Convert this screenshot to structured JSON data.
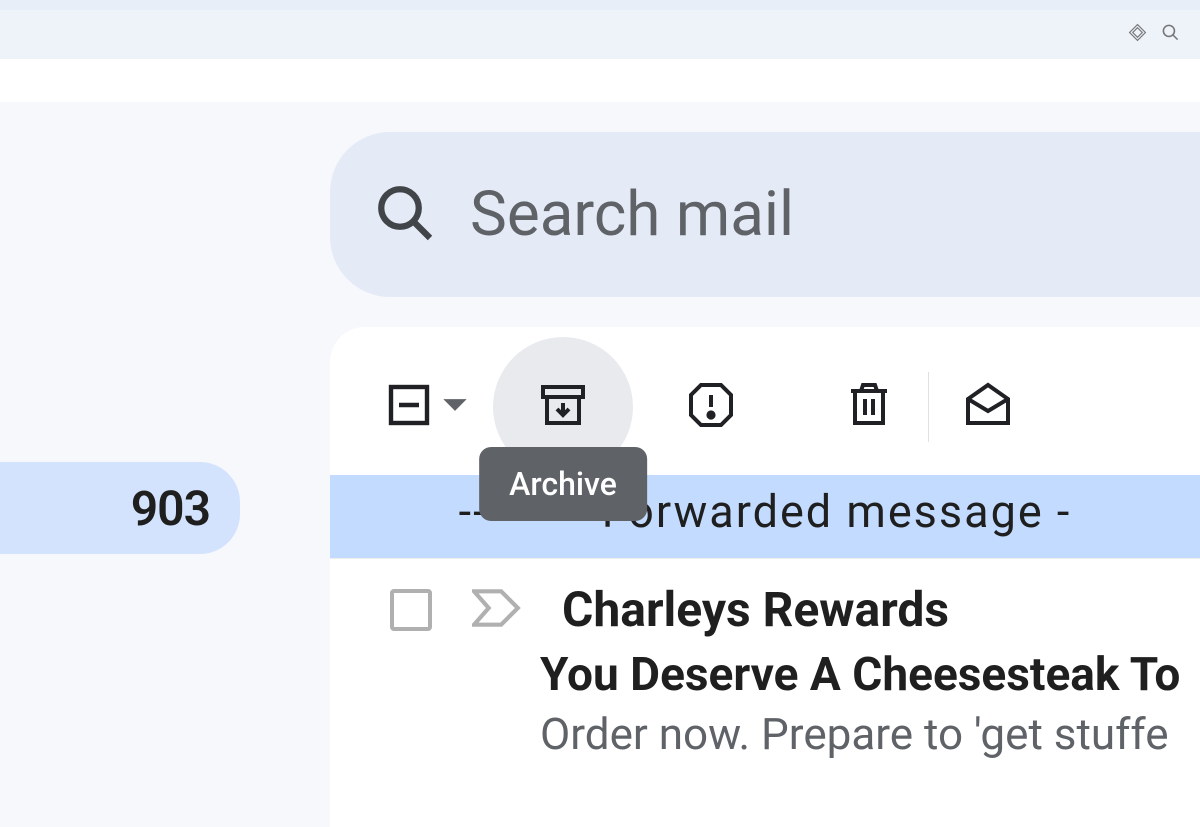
{
  "browser": {},
  "search": {
    "placeholder": "Search mail"
  },
  "sidebar": {
    "count": "903"
  },
  "toolbar": {
    "tooltip": "Archive"
  },
  "selected_row": {
    "snippet": "--------- Forwarded message -"
  },
  "row": {
    "sender": "Charleys Rewards",
    "subject": "You Deserve A Cheesesteak To",
    "snippet": "Order now. Prepare to 'get stuffe"
  }
}
